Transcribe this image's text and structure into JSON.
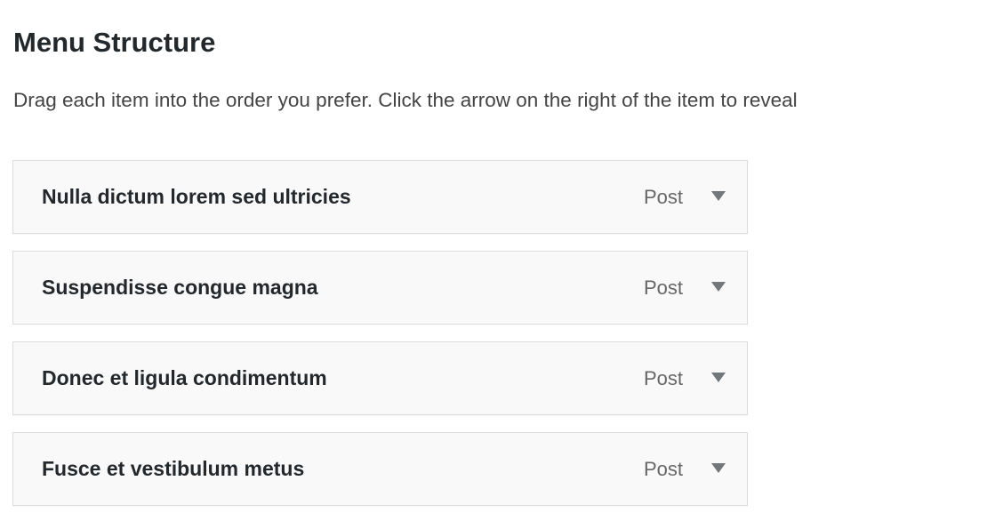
{
  "heading": "Menu Structure",
  "description": "Drag each item into the order you prefer. Click the arrow on the right of the item to reveal",
  "items": [
    {
      "title": "Nulla dictum lorem sed ultricies",
      "type": "Post"
    },
    {
      "title": "Suspendisse congue magna",
      "type": "Post"
    },
    {
      "title": "Donec et ligula condimentum",
      "type": "Post"
    },
    {
      "title": "Fusce et vestibulum metus",
      "type": "Post"
    }
  ]
}
